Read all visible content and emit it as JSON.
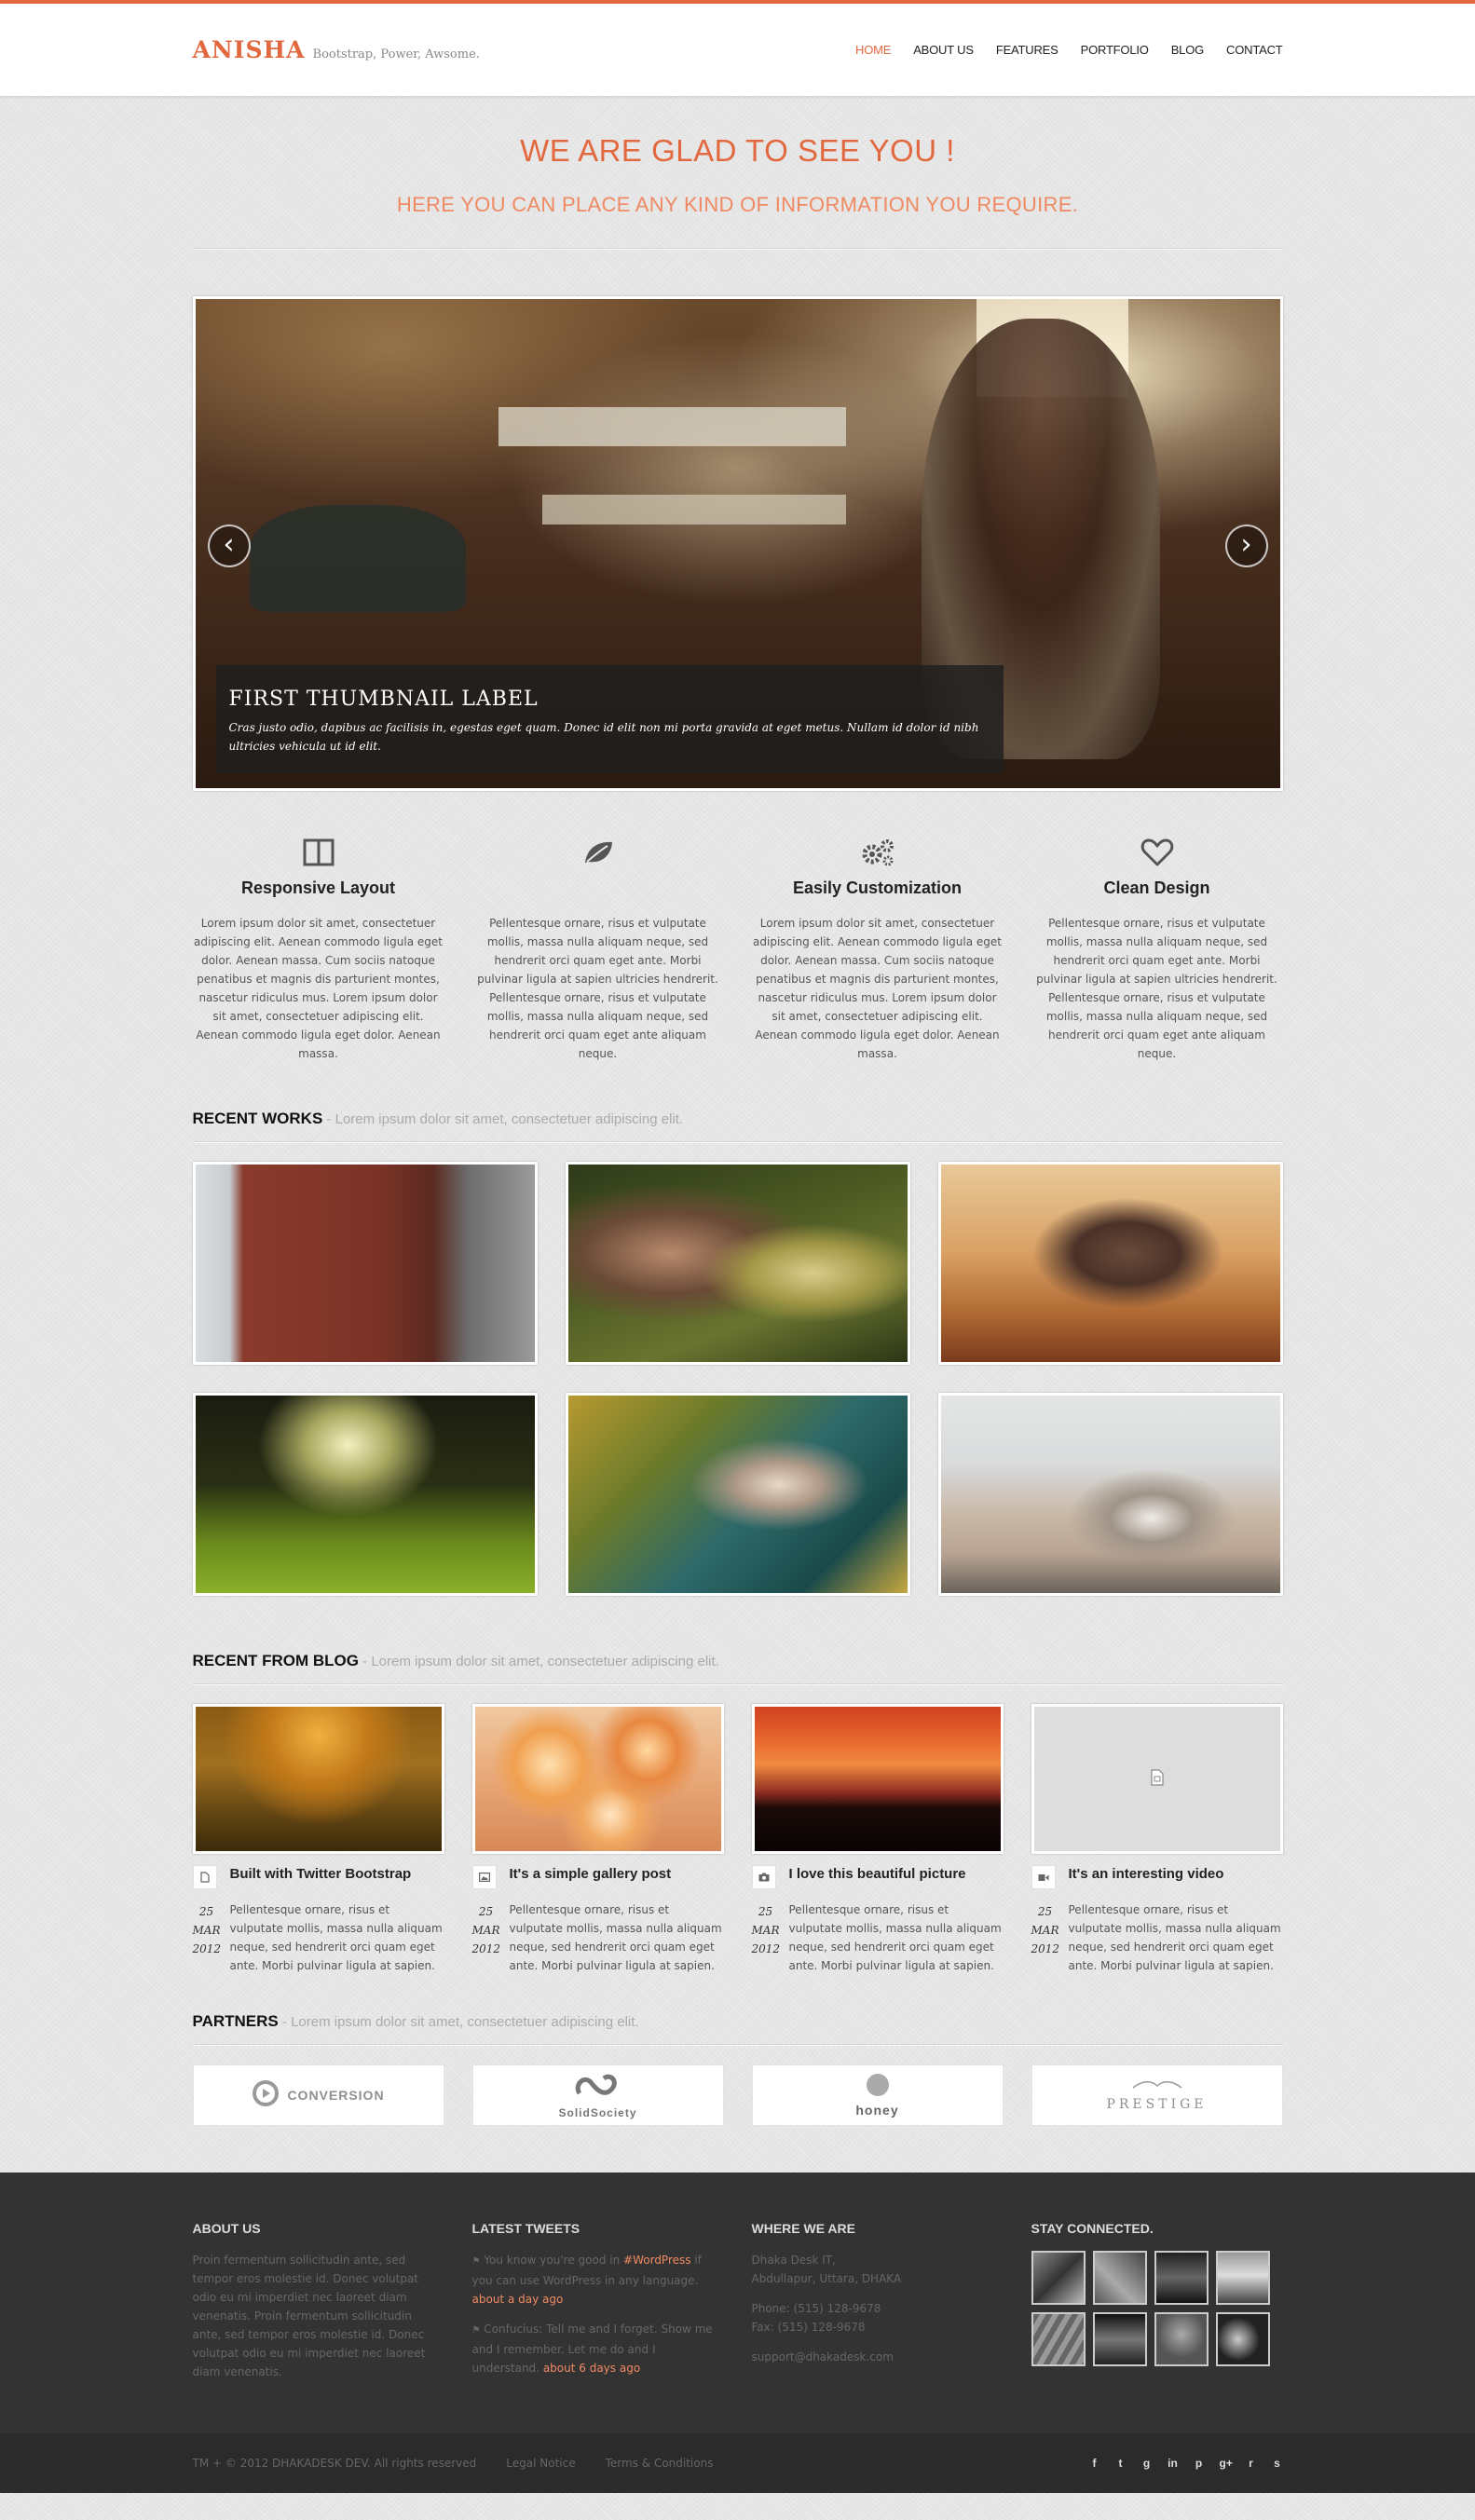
{
  "header": {
    "brand": "ANISHA",
    "tagline": "Bootstrap, Power, Awsome.",
    "nav": [
      "HOME",
      "ABOUT US",
      "FEATURES",
      "PORTFOLIO",
      "BLOG",
      "CONTACT"
    ],
    "active_nav": "HOME",
    "accent_color": "#e2693f"
  },
  "hero": {
    "title": "WE ARE GLAD TO SEE YOU !",
    "subtitle": "HERE YOU CAN PLACE ANY KIND OF INFORMATION YOU REQUIRE."
  },
  "slider": {
    "prev_glyph": "‹",
    "next_glyph": "›",
    "caption_title": "FIRST THUMBNAIL LABEL",
    "caption_text": "Cras justo odio, dapibus ac facilisis in, egestas eget quam. Donec id elit non mi porta gravida at eget metus. Nullam id dolor id nibh ultricies vehicula ut id elit."
  },
  "features": [
    {
      "icon": "columns-icon",
      "title": "Responsive Layout",
      "text": "Lorem ipsum dolor sit amet, consectetuer adipiscing elit. Aenean commodo ligula eget dolor. Aenean massa. Cum sociis natoque penatibus et magnis dis parturient montes, nascetur ridiculus mus. Lorem ipsum dolor sit amet, consectetuer adipiscing elit. Aenean commodo ligula eget dolor. Aenean massa."
    },
    {
      "icon": "leaf-icon",
      "title": "",
      "text": "Pellentesque ornare, risus et vulputate mollis, massa nulla aliquam neque, sed hendrerit orci quam eget ante. Morbi pulvinar ligula at sapien ultricies hendrerit. Pellentesque ornare, risus et vulputate mollis, massa nulla aliquam neque, sed hendrerit orci quam eget ante aliquam neque."
    },
    {
      "icon": "cogs-icon",
      "title": "Easily Customization",
      "text": "Lorem ipsum dolor sit amet, consectetuer adipiscing elit. Aenean commodo ligula eget dolor. Aenean massa. Cum sociis natoque penatibus et magnis dis parturient montes, nascetur ridiculus mus. Lorem ipsum dolor sit amet, consectetuer adipiscing elit. Aenean commodo ligula eget dolor. Aenean massa."
    },
    {
      "icon": "heart-icon",
      "title": "Clean Design",
      "text": "Pellentesque ornare, risus et vulputate mollis, massa nulla aliquam neque, sed hendrerit orci quam eget ante. Morbi pulvinar ligula at sapien ultricies hendrerit. Pellentesque ornare, risus et vulputate mollis, massa nulla aliquam neque, sed hendrerit orci quam eget ante aliquam neque."
    }
  ],
  "works": {
    "title": "RECENT WORKS",
    "subtitle": " - Lorem ipsum dolor sit amet, consectetuer adipiscing elit."
  },
  "blog": {
    "title": "RECENT FROM BLOG",
    "subtitle": " - Lorem ipsum dolor sit amet, consectetuer adipiscing elit.",
    "posts": [
      {
        "icon": "document-icon",
        "title": "Built with Twitter Bootstrap",
        "day": "25",
        "month": "MAR",
        "year": "2012",
        "text": "Pellentesque ornare, risus et vulputate mollis, massa nulla aliquam neque, sed hendrerit orci quam eget ante. Morbi pulvinar ligula at sapien."
      },
      {
        "icon": "image-icon",
        "title": "It's a simple gallery post",
        "day": "25",
        "month": "MAR",
        "year": "2012",
        "text": "Pellentesque ornare, risus et vulputate mollis, massa nulla aliquam neque, sed hendrerit orci quam eget ante. Morbi pulvinar ligula at sapien."
      },
      {
        "icon": "camera-icon",
        "title": "I love this beautiful picture",
        "day": "25",
        "month": "MAR",
        "year": "2012",
        "text": "Pellentesque ornare, risus et vulputate mollis, massa nulla aliquam neque, sed hendrerit orci quam eget ante. Morbi pulvinar ligula at sapien."
      },
      {
        "icon": "video-icon",
        "title": "It's an interesting video",
        "day": "25",
        "month": "MAR",
        "year": "2012",
        "text": "Pellentesque ornare, risus et vulputate mollis, massa nulla aliquam neque, sed hendrerit orci quam eget ante. Morbi pulvinar ligula at sapien."
      }
    ]
  },
  "partners": {
    "title": "PARTNERS",
    "subtitle": " - Lorem ipsum dolor sit amet, consectetuer adipiscing elit.",
    "logos": [
      "CONVERSION",
      "SolidSociety",
      "honey",
      "PRESTIGE"
    ]
  },
  "footer": {
    "about_title": "ABOUT US",
    "about_text": "Proin fermentum sollicitudin ante, sed tempor eros molestie id. Donec volutpat odio eu mi imperdiet nec laoreet diam venenatis. Proin fermentum sollicitudin ante, sed tempor eros molestie id. Donec volutpat odio eu mi imperdiet nec laoreet diam venenatis.",
    "tweets_title": "LATEST TWEETS",
    "tweet1_before": "You know you're good in ",
    "tweet1_tag": "#WordPress",
    "tweet1_after": " if you can use WordPress in any language.",
    "tweet1_time": "about a day ago",
    "tweet2_text": "Confucius: Tell me and I forget. Show me and I remember. Let me do and I understand.",
    "tweet2_time": "about 6 days ago",
    "where_title": "WHERE WE ARE",
    "address1": "Dhaka Desk IT,",
    "address2": "Abdullapur, Uttara, DHAKA",
    "phone": "Phone: (515) 128-9678",
    "fax": "Fax: (515) 128-9678",
    "email": "support@dhakadesk.com",
    "connect_title": "STAY CONNECTED."
  },
  "bottom": {
    "copyright": "TM + © 2012 DHAKADESK DEV. All rights reserved",
    "legal": "Legal Notice",
    "terms": "Terms & Conditions",
    "socials": [
      "f",
      "t",
      "g",
      "in",
      "p",
      "g+",
      "r",
      "s"
    ]
  }
}
